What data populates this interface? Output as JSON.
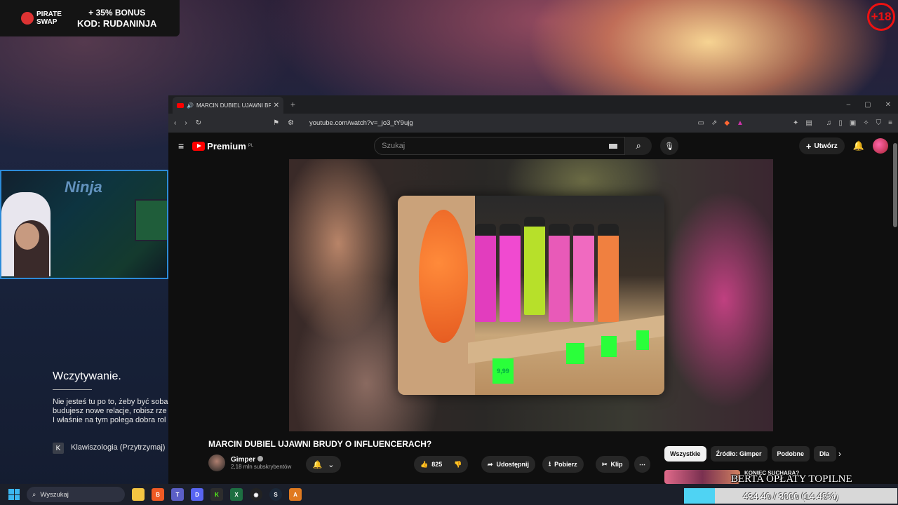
{
  "overlay": {
    "promo": {
      "brand_line1": "PIRATE",
      "brand_line2": "SWAP",
      "bonus": "+ 35% BONUS",
      "code": "KOD: RUDANINJA"
    },
    "age_badge": "+18",
    "webcam_sign": "Ninja",
    "loading": {
      "title": "Wczytywanie.",
      "description": "Nie jesteś tu po to, żeby być soba\nbudujesz nowe relacje, robisz rze\nI właśnie na tym polega dobra rol",
      "key": "K",
      "key_label": "Klawiszologia (Przytrzymaj)"
    },
    "alert_text": "BERTA OPŁATY TOPILNE",
    "goal": {
      "text": "434.40 / 3000 (14.48%)",
      "progress": 0.1448
    }
  },
  "browser": {
    "tab_title": "MARCIN DUBIEL UJAWNI BRUDY O INFLUENCERACH?",
    "new_tab": "+",
    "url": "youtube.com/watch?v=_jo3_tY9ujg",
    "window_controls": [
      "–",
      "▢",
      "✕"
    ]
  },
  "youtube": {
    "logo": "Premium",
    "logo_region": "PL",
    "search_placeholder": "Szukaj",
    "create_label": "Utwórz",
    "video": {
      "title": "MARCIN DUBIEL UJAWNI BRUDY O INFLUENCERACH?",
      "channel": "Gimper",
      "subscribers": "2,18 mln subskrybentów",
      "likes": "825",
      "share": "Udostępnij",
      "download": "Pobierz",
      "clip": "Klip",
      "price_tag": "9,99"
    },
    "chips": [
      "Wszystkie",
      "Źródło: Gimper",
      "Podobne",
      "Dla"
    ],
    "recommendation": {
      "title": "KONIEC SUCHARA?"
    }
  },
  "taskbar": {
    "search_placeholder": "Wyszukaj",
    "icons": [
      "file-explorer",
      "brave",
      "teams",
      "discord",
      "kick",
      "excel",
      "obs",
      "steam",
      "app"
    ]
  },
  "colors": {
    "accent_cyan": "#4fd3f3",
    "youtube_red": "#ff0000",
    "age_red": "#e11111"
  }
}
